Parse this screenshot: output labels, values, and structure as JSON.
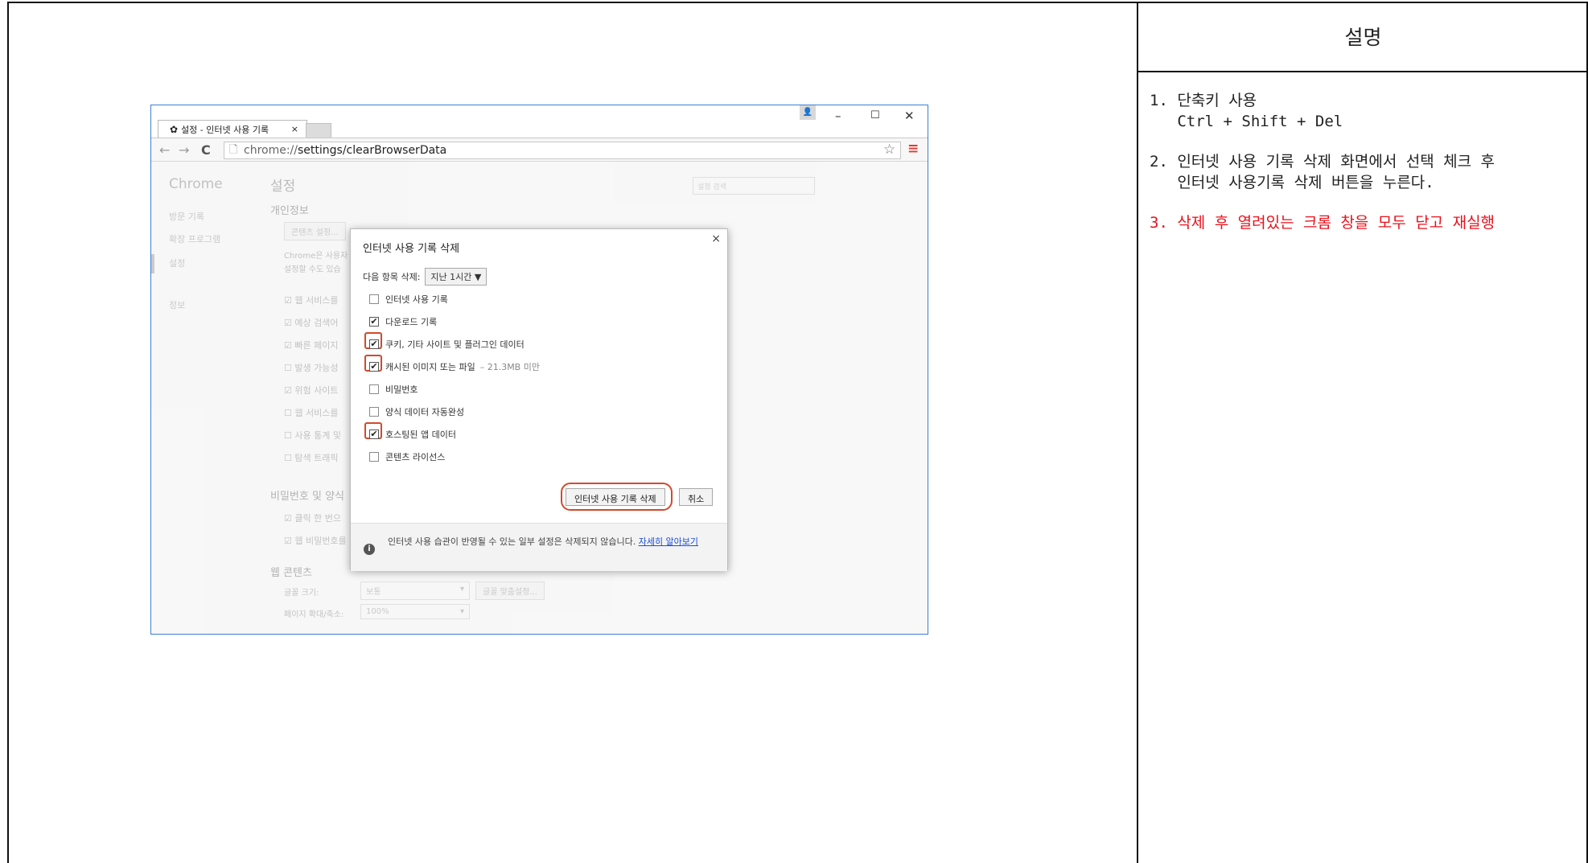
{
  "right_panel": {
    "header": "설명",
    "notes": [
      {
        "lines": [
          "1. 단축키 사용",
          "   Ctrl + Shift + Del"
        ]
      },
      {
        "lines": [
          "2. 인터넷 사용 기록 삭제 화면에서 선택 체크 후",
          "   인터넷 사용기록 삭제 버튼을 누른다."
        ]
      },
      {
        "lines": [
          "3. 삭제 후 열려있는 크롬 창을 모두 닫고 재실행"
        ],
        "color": "#e8111b"
      }
    ]
  },
  "browser": {
    "tab_title": "설정 - 인터넷 사용 기록",
    "tab_close": "×",
    "window_controls": {
      "minimize": "–",
      "maximize": "☐",
      "close": "✕"
    },
    "user_icon": "user-icon",
    "url_scheme": "chrome://",
    "url_path": "settings/clearBrowserData",
    "accent_border": "#3b7fd6",
    "menu_color": "#e53935"
  },
  "settings_bg": {
    "brand": "Chrome",
    "nav": [
      "방문 기록",
      "확장 프로그램",
      "설정",
      "정보"
    ],
    "title": "설정",
    "search_placeholder": "설정 검색",
    "section_privacy": "개인정보",
    "content_settings_btn": "콘텐츠 설정...",
    "privacy_desc_1": "Chrome은 사용자",
    "privacy_desc_2": "설정할 수도 있습",
    "rows": [
      "웹 서비스를",
      "예상 검색어",
      "빠른 페이지",
      "발생 가능성",
      "위험 사이트",
      "웹 서비스를",
      "사용 통계 및",
      "탐색 트래픽"
    ],
    "section_passwords": "비밀번호 및 양식",
    "password_rows": [
      "클릭 한 번으",
      "웹 비밀번호를"
    ],
    "section_web_content": "웹 콘텐츠",
    "font_size_label": "글꼴 크기:",
    "font_size_value": "보통",
    "font_customize_btn": "글꼴 맞춤설정...",
    "zoom_label": "페이지 확대/축소:",
    "zoom_value": "100%"
  },
  "dialog": {
    "title": "인터넷 사용 기록 삭제",
    "close": "×",
    "range_label": "다음 항목 삭제:",
    "range_value": "지난 1시간",
    "items": [
      {
        "label": "인터넷 사용 기록",
        "checked": false
      },
      {
        "label": "다운로드 기록",
        "checked": true
      },
      {
        "label": "쿠키, 기타 사이트 및 플러그인 데이터",
        "checked": true,
        "highlighted": true
      },
      {
        "label": "캐시된 이미지 또는 파일",
        "checked": true,
        "highlighted": true,
        "note": "–  21.3MB 미만"
      },
      {
        "label": "비밀번호",
        "checked": false
      },
      {
        "label": "양식 데이터 자동완성",
        "checked": false
      },
      {
        "label": "호스팅된 앱 데이터",
        "checked": true,
        "highlighted": true
      },
      {
        "label": "콘텐츠 라이선스",
        "checked": false
      }
    ],
    "clear_button": "인터넷 사용 기록 삭제",
    "cancel_button": "취소",
    "footer_text": "인터넷 사용 습관이 반영될 수 있는 일부 설정은 삭제되지 않습니다. ",
    "footer_link": "자세히 알아보기",
    "highlight_color": "#d24a2b"
  }
}
